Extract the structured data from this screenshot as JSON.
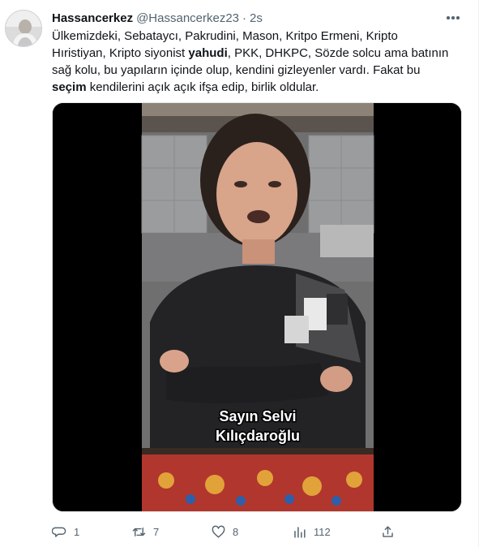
{
  "tweet": {
    "author_name": "Hassancerkez",
    "author_handle": "@Hassancerkez23",
    "separator": "·",
    "time": "2s",
    "text": {
      "l1": "Ülkemizdeki, Sebataycı, Pakrudini, Mason, Kritpo Ermeni, Kripto",
      "l2a": "Hıristiyan, Kripto siyonist ",
      "l2b": "yahudi",
      "l2c": ", PKK, DHKPC, Sözde solcu ama batının",
      "l3": "sağ kolu, bu yapıların içinde olup, kendini gizleyenler vardı. Fakat bu",
      "l4a": "seçim",
      "l4b": " kendilerini açık açık ifşa edip, birlik oldular."
    },
    "media": {
      "caption_line1": "Sayın Selvi",
      "caption_line2": "Kılıçdaroğlu"
    },
    "stats": {
      "replies": "1",
      "retweets": "7",
      "likes": "8",
      "views": "112"
    }
  },
  "colors": {
    "text_primary": "#0f1419",
    "text_secondary": "#536471",
    "border": "#eff3f4"
  },
  "icons": [
    "more-icon",
    "reply-icon",
    "retweet-icon",
    "like-icon",
    "views-icon",
    "share-icon"
  ]
}
